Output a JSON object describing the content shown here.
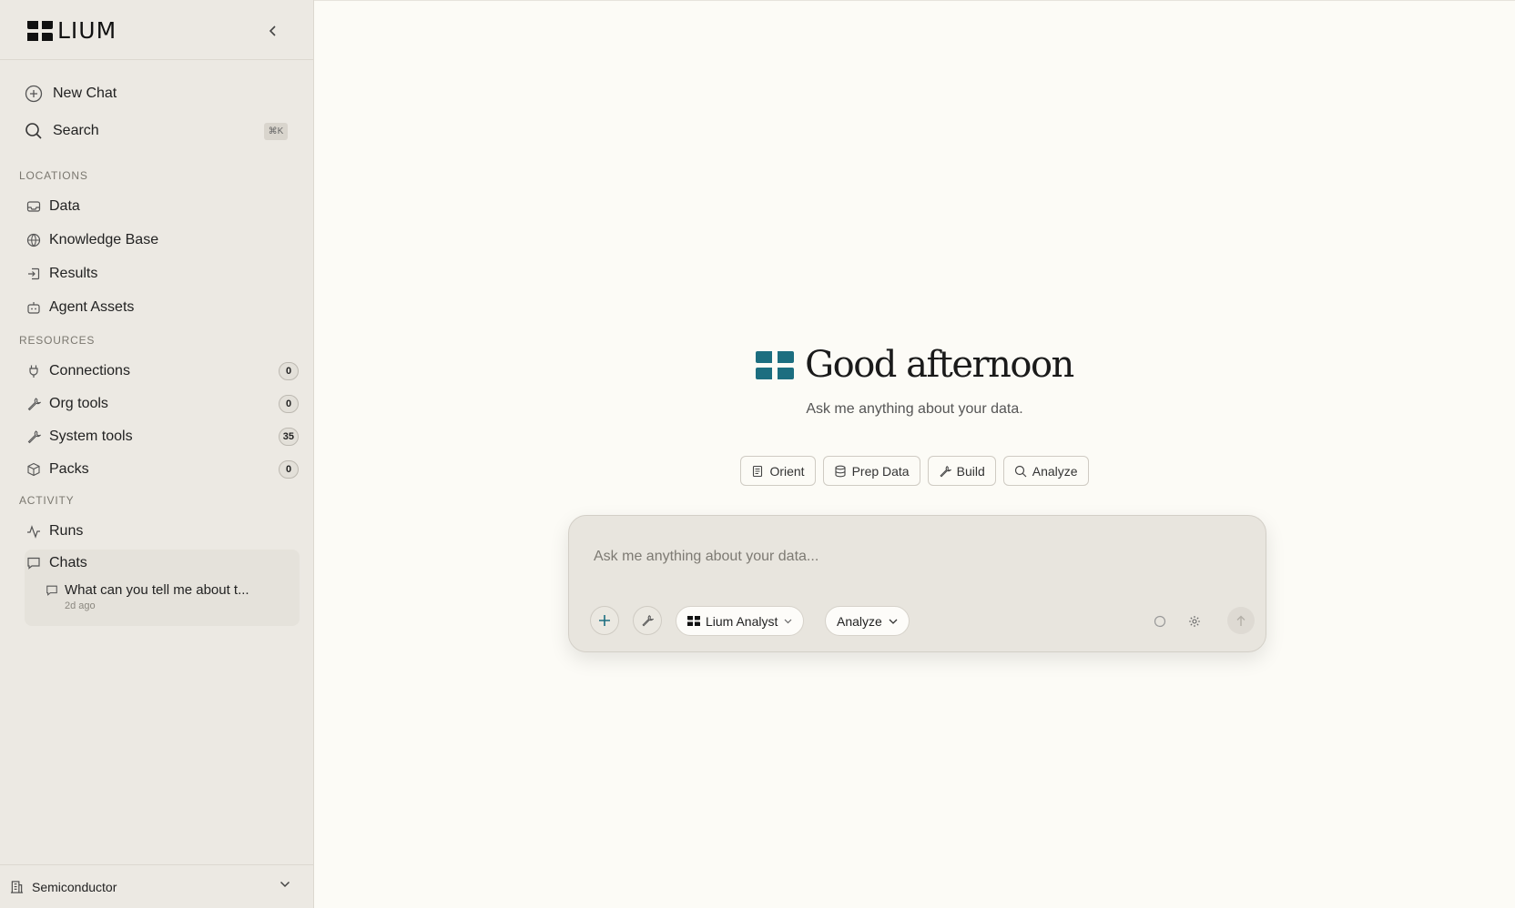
{
  "app": {
    "name": "LIUM"
  },
  "sidebar": {
    "new_chat": "New Chat",
    "search": "Search",
    "search_shortcut": "⌘K",
    "sections": {
      "locations": "LOCATIONS",
      "resources": "RESOURCES",
      "activity": "ACTIVITY"
    },
    "locations": [
      {
        "label": "Data",
        "icon": "inbox-icon"
      },
      {
        "label": "Knowledge Base",
        "icon": "globe-icon"
      },
      {
        "label": "Results",
        "icon": "export-icon"
      },
      {
        "label": "Agent Assets",
        "icon": "bot-icon"
      }
    ],
    "resources": [
      {
        "label": "Connections",
        "count": "0",
        "icon": "plug-icon"
      },
      {
        "label": "Org tools",
        "count": "0",
        "icon": "wrench-icon"
      },
      {
        "label": "System tools",
        "count": "35",
        "icon": "wrench-icon"
      },
      {
        "label": "Packs",
        "count": "0",
        "icon": "package-icon"
      }
    ],
    "activity": [
      {
        "label": "Runs",
        "icon": "activity-icon"
      },
      {
        "label": "Chats",
        "icon": "message-icon"
      }
    ],
    "recent_chat": {
      "title": "What can you tell me about t...",
      "time": "2d ago"
    },
    "workspace": "Semiconductor"
  },
  "main": {
    "greeting": "Good afternoon",
    "subtitle": "Ask me anything about your data.",
    "quick_actions": [
      {
        "label": "Orient",
        "icon": "clipboard-icon"
      },
      {
        "label": "Prep Data",
        "icon": "database-icon"
      },
      {
        "label": "Build",
        "icon": "wrench-icon"
      },
      {
        "label": "Analyze",
        "icon": "search-icon"
      }
    ],
    "composer": {
      "placeholder": "Ask me anything about your data...",
      "agent": "Lium Analyst",
      "mode": "Analyze"
    }
  },
  "colors": {
    "brand": "#1c6e80",
    "background": "#fcfbf6",
    "sidebar": "#ece9e3"
  }
}
